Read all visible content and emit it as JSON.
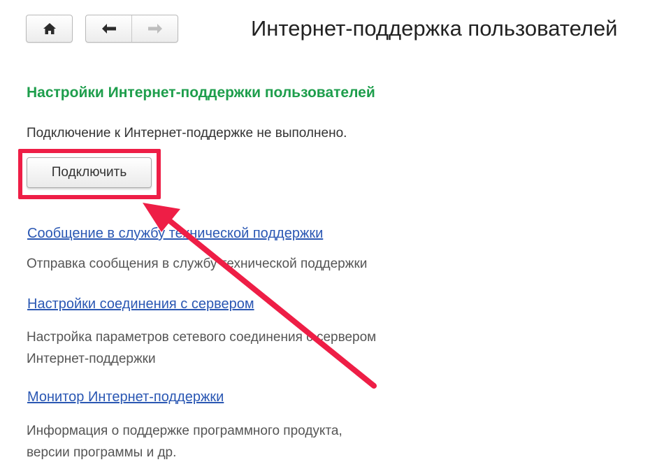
{
  "toolbar": {
    "home_icon": "home-icon",
    "back_icon": "arrow-left-icon",
    "forward_icon": "arrow-right-icon"
  },
  "page": {
    "title": "Интернет-поддержка пользователей"
  },
  "settings": {
    "section_title": "Настройки Интернет-поддержки пользователей",
    "status": "Подключение к Интернет-поддержке не выполнено.",
    "connect_label": "Подключить"
  },
  "links": [
    {
      "label": "Сообщение в службу технической поддержки",
      "description": "Отправка сообщения в службу технической поддержки"
    },
    {
      "label": "Настройки соединения с сервером",
      "description_line1": "Настройка параметров сетевого соединения с сервером",
      "description_line2": "Интернет-поддержки"
    },
    {
      "label": "Монитор Интернет-поддержки",
      "description_line1": "Информация о поддержке программного продукта,",
      "description_line2": "версии программы и др."
    }
  ],
  "colors": {
    "accent_green": "#1e9e4c",
    "link_blue": "#2a57b3",
    "annotation_red": "#ee1e46"
  }
}
